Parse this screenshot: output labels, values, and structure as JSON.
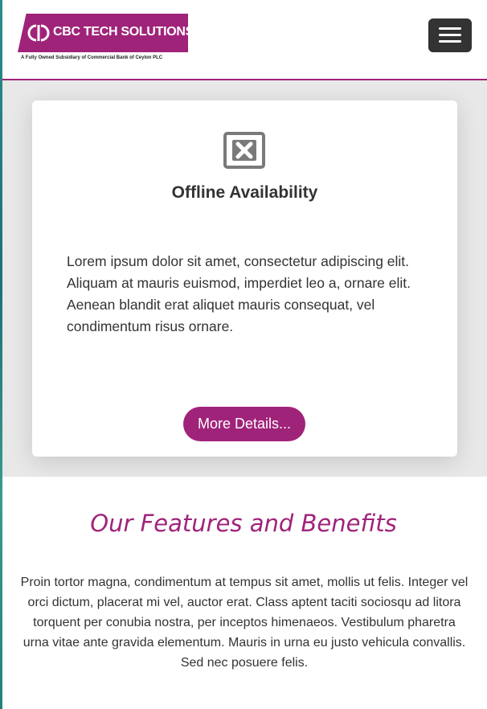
{
  "header": {
    "logo_text": "CBC TECH SOLUTIONS",
    "logo_tagline": "A Fully Owned Subsidiary of Commercial Bank of Ceylon PLC",
    "menu_icon": "hamburger-icon"
  },
  "card": {
    "icon": "broken-image-icon",
    "title": "Offline Availability",
    "body": "Lorem ipsum dolor sit amet, consectetur adipiscing elit. Aliquam at mauris euismod, imperdiet leo a, ornare elit. Aenean blandit erat aliquet mauris consequat, vel condimentum risus ornare.",
    "button_label": "More Details..."
  },
  "features": {
    "title": "Our Features and Benefits",
    "body": "Proin tortor magna, condimentum at tempus sit amet, mollis ut felis. Integer vel orci dictum, placerat mi vel, auctor erat. Class aptent taciti sociosqu ad litora torquent per conubia nostra, per inceptos himenaeos. Vestibulum pharetra urna vitae ante gravida elementum. Mauris in urna eu justo vehicula convallis. Sed nec posuere felis."
  },
  "colors": {
    "brand": "#a0237a",
    "menu_button": "#333333",
    "band": "#e8e8e8"
  }
}
